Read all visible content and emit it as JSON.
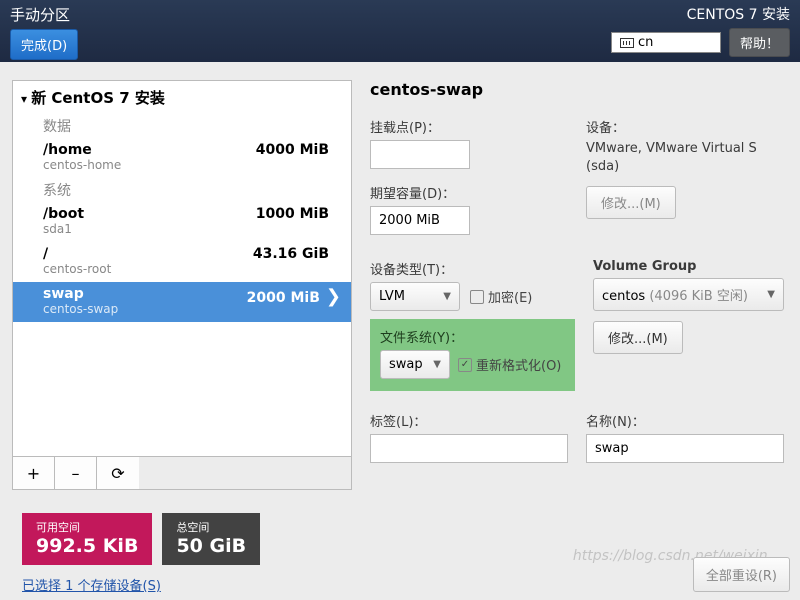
{
  "header": {
    "title": "手动分区",
    "done_label": "完成(D)",
    "right_title": "CENTOS 7 安装",
    "lang": "cn",
    "help_label": "帮助！"
  },
  "tree": {
    "root_label": "新 CentOS 7 安装",
    "section_data": "数据",
    "section_system": "系统",
    "entries": [
      {
        "name": "/home",
        "sub": "centos-home",
        "size": "4000 MiB"
      },
      {
        "name": "/boot",
        "sub": "sda1",
        "size": "1000 MiB"
      },
      {
        "name": "/",
        "sub": "centos-root",
        "size": "43.16 GiB"
      },
      {
        "name": "swap",
        "sub": "centos-swap",
        "size": "2000 MiB"
      }
    ]
  },
  "btns": {
    "add": "+",
    "remove": "–",
    "reload": "⟳"
  },
  "right": {
    "title": "centos-swap",
    "mount_label": "挂载点(P)：",
    "mount_val": "",
    "cap_label": "期望容量(D)：",
    "cap_val": "2000 MiB",
    "device_label": "设备：",
    "device_text": "VMware, VMware Virtual S (sda)",
    "modify_label": "修改...(M)",
    "devtype_label": "设备类型(T)：",
    "devtype_val": "LVM",
    "encrypt_label": "加密(E)",
    "vg_label": "Volume Group",
    "vg_val": "centos",
    "vg_free": "(4096 KiB 空闲)",
    "fs_label": "文件系统(Y)：",
    "fs_val": "swap",
    "reformat_label": "重新格式化(O)",
    "tag_label": "标签(L)：",
    "tag_val": "",
    "name_label": "名称(N)：",
    "name_val": "swap"
  },
  "bottom": {
    "avail_label": "可用空间",
    "avail_val": "992.5 KiB",
    "total_label": "总空间",
    "total_val": "50 GiB",
    "storage_link": "已选择 1 个存储设备(S)",
    "reset_label": "全部重设(R)"
  },
  "watermark": "https://blog.csdn.net/weixin_..."
}
